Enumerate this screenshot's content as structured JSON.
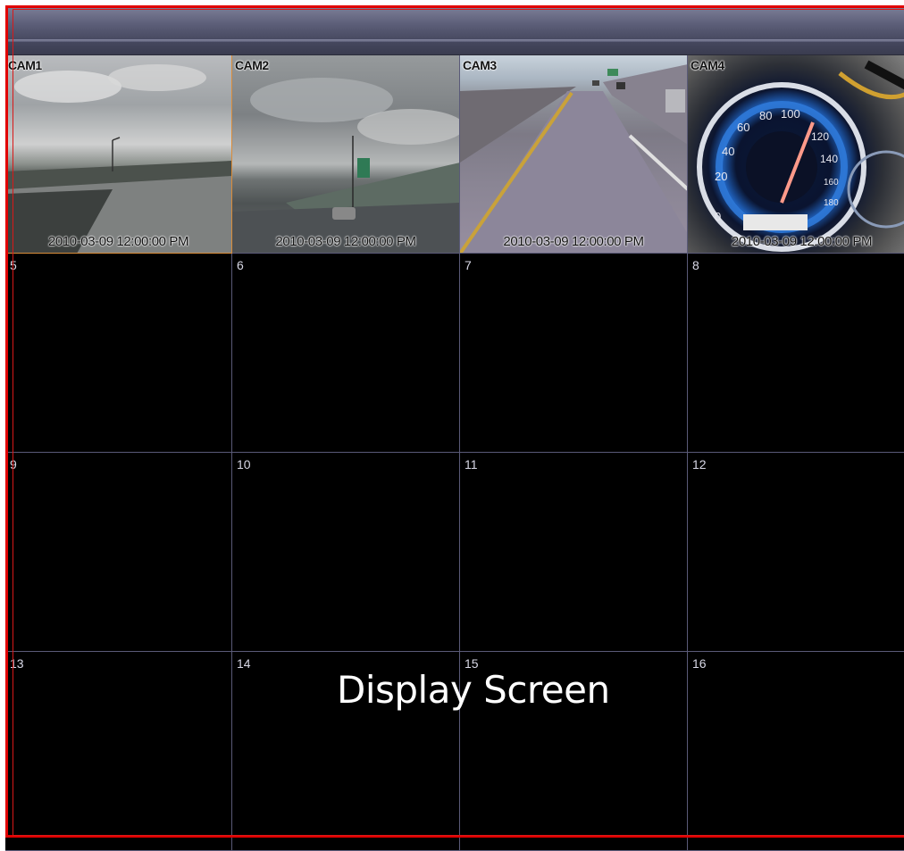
{
  "window": {
    "title": ""
  },
  "cameras": [
    {
      "label": "CAM1",
      "timestamp": "2010-03-09 12:00:00 PM"
    },
    {
      "label": "CAM2",
      "timestamp": "2010-03-09 12:00:00 PM"
    },
    {
      "label": "CAM3",
      "timestamp": "2010-03-09 12:00:00 PM"
    },
    {
      "label": "CAM4",
      "timestamp": "2010-03-09 12:00:00 PM"
    }
  ],
  "channels": [
    "5",
    "6",
    "7",
    "8",
    "9",
    "10",
    "11",
    "12",
    "13",
    "14",
    "15",
    "16"
  ],
  "annotation": {
    "label": "Display Screen",
    "outline_color": "#e10000"
  },
  "colors": {
    "grid_line": "#5a5a78",
    "selected_border": "#d98c3a",
    "background": "#000000"
  }
}
